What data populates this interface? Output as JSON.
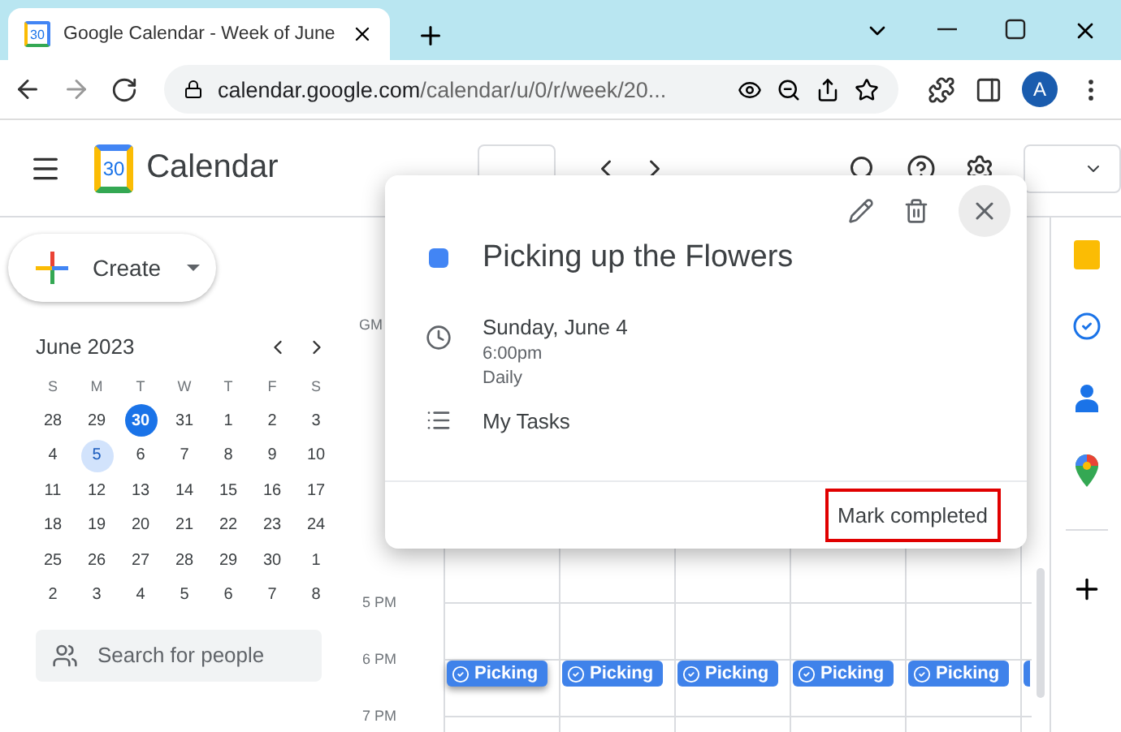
{
  "browser": {
    "tab_title": "Google Calendar - Week of June",
    "favicon_text": "30",
    "address_host": "calendar.google.com",
    "address_path": "/calendar/u/0/r/week/20...",
    "profile_initial": "A"
  },
  "header": {
    "logo_text": "30",
    "title": "Calendar"
  },
  "sidebar": {
    "create": "Create",
    "mini_calendar": {
      "month": "June 2023",
      "weekdays": [
        "S",
        "M",
        "T",
        "W",
        "T",
        "F",
        "S"
      ],
      "weeks": [
        [
          {
            "label": "28",
            "today": false,
            "selected": false
          },
          {
            "label": "29",
            "today": false,
            "selected": false
          },
          {
            "label": "30",
            "today": true,
            "selected": false
          },
          {
            "label": "31",
            "today": false,
            "selected": false
          },
          {
            "label": "1",
            "today": false,
            "selected": false
          },
          {
            "label": "2",
            "today": false,
            "selected": false
          },
          {
            "label": "3",
            "today": false,
            "selected": false
          }
        ],
        [
          {
            "label": "4",
            "today": false,
            "selected": false
          },
          {
            "label": "5",
            "today": false,
            "selected": true
          },
          {
            "label": "6",
            "today": false,
            "selected": false
          },
          {
            "label": "7",
            "today": false,
            "selected": false
          },
          {
            "label": "8",
            "today": false,
            "selected": false
          },
          {
            "label": "9",
            "today": false,
            "selected": false
          },
          {
            "label": "10",
            "today": false,
            "selected": false
          }
        ],
        [
          {
            "label": "11",
            "today": false,
            "selected": false
          },
          {
            "label": "12",
            "today": false,
            "selected": false
          },
          {
            "label": "13",
            "today": false,
            "selected": false
          },
          {
            "label": "14",
            "today": false,
            "selected": false
          },
          {
            "label": "15",
            "today": false,
            "selected": false
          },
          {
            "label": "16",
            "today": false,
            "selected": false
          },
          {
            "label": "17",
            "today": false,
            "selected": false
          }
        ],
        [
          {
            "label": "18",
            "today": false,
            "selected": false
          },
          {
            "label": "19",
            "today": false,
            "selected": false
          },
          {
            "label": "20",
            "today": false,
            "selected": false
          },
          {
            "label": "21",
            "today": false,
            "selected": false
          },
          {
            "label": "22",
            "today": false,
            "selected": false
          },
          {
            "label": "23",
            "today": false,
            "selected": false
          },
          {
            "label": "24",
            "today": false,
            "selected": false
          }
        ],
        [
          {
            "label": "25",
            "today": false,
            "selected": false
          },
          {
            "label": "26",
            "today": false,
            "selected": false
          },
          {
            "label": "27",
            "today": false,
            "selected": false
          },
          {
            "label": "28",
            "today": false,
            "selected": false
          },
          {
            "label": "29",
            "today": false,
            "selected": false
          },
          {
            "label": "30",
            "today": false,
            "selected": false
          },
          {
            "label": "1",
            "today": false,
            "selected": false
          }
        ],
        [
          {
            "label": "2",
            "today": false,
            "selected": false
          },
          {
            "label": "3",
            "today": false,
            "selected": false
          },
          {
            "label": "4",
            "today": false,
            "selected": false
          },
          {
            "label": "5",
            "today": false,
            "selected": false
          },
          {
            "label": "6",
            "today": false,
            "selected": false
          },
          {
            "label": "7",
            "today": false,
            "selected": false
          },
          {
            "label": "8",
            "today": false,
            "selected": false
          }
        ]
      ]
    },
    "people_search": {
      "placeholder": "Search for people"
    }
  },
  "grid": {
    "timezone": "GM",
    "hours": [
      "5 PM",
      "6 PM",
      "7 PM"
    ],
    "events": [
      {
        "label": "Picking"
      },
      {
        "label": "Picking"
      },
      {
        "label": "Picking"
      },
      {
        "label": "Picking"
      },
      {
        "label": "Picking"
      }
    ]
  },
  "popup": {
    "title": "Picking up the Flowers",
    "date": "Sunday, June 4",
    "time": "6:00pm",
    "recurrence": "Daily",
    "calendar": "My Tasks",
    "action": {
      "label": "Mark completed",
      "highlighted": true
    }
  }
}
